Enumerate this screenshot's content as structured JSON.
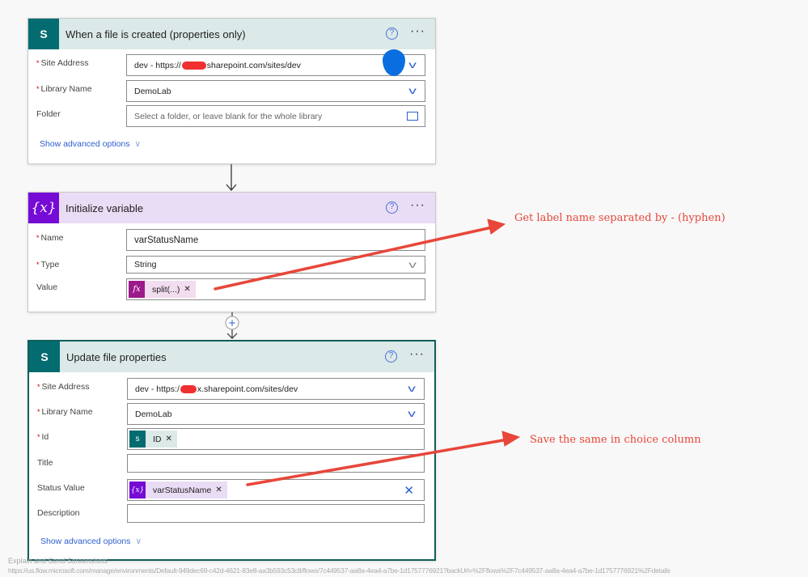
{
  "trigger": {
    "title": "When a file is created (properties only)",
    "icon": "sharepoint-icon",
    "site_label": "Site Address",
    "site_prefix": "dev - https://",
    "site_suffix": "sharepoint.com/sites/dev",
    "library_label": "Library Name",
    "library_value": "DemoLab",
    "folder_label": "Folder",
    "folder_placeholder": "Select a folder, or leave blank for the whole library",
    "advanced": "Show advanced options"
  },
  "init_var": {
    "title": "Initialize variable",
    "icon": "variable-icon",
    "icon_text": "{x}",
    "name_label": "Name",
    "name_value": "varStatusName",
    "type_label": "Type",
    "type_value": "String",
    "value_label": "Value",
    "token": "split(...)",
    "token_icon": "fx"
  },
  "update": {
    "title": "Update file properties",
    "icon": "sharepoint-icon",
    "site_label": "Site Address",
    "site_prefix": "dev - https:/",
    "site_suffix": "x.sharepoint.com/sites/dev",
    "library_label": "Library Name",
    "library_value": "DemoLab",
    "id_label": "Id",
    "id_token": "ID",
    "title_label": "Title",
    "status_label": "Status Value",
    "status_token": "varStatusName",
    "status_token_icon": "{x}",
    "description_label": "Description",
    "advanced": "Show advanced options"
  },
  "annotations": {
    "first": "Get label name separated by - (hyphen)",
    "second": "Save the same in choice column"
  },
  "footer": {
    "title": "Explain and Send Screenshots",
    "url": "https://us.flow.microsoft.com/manage/environments/Default-949dec69-c42d-4621-83e8-aa3b593c53c8/flows/7c449537-aa8a-4ea4-a7be-1d1757776921?backUrl=%2Fflows%2F7c449537-aa8a-4ea4-a7be-1d1757776921%2Fdetails"
  },
  "colors": {
    "sharepoint": "#036c70",
    "variable": "#770bd6",
    "expression": "#9c1a8c",
    "annotation": "#e8463a",
    "link": "#2b5fce"
  }
}
